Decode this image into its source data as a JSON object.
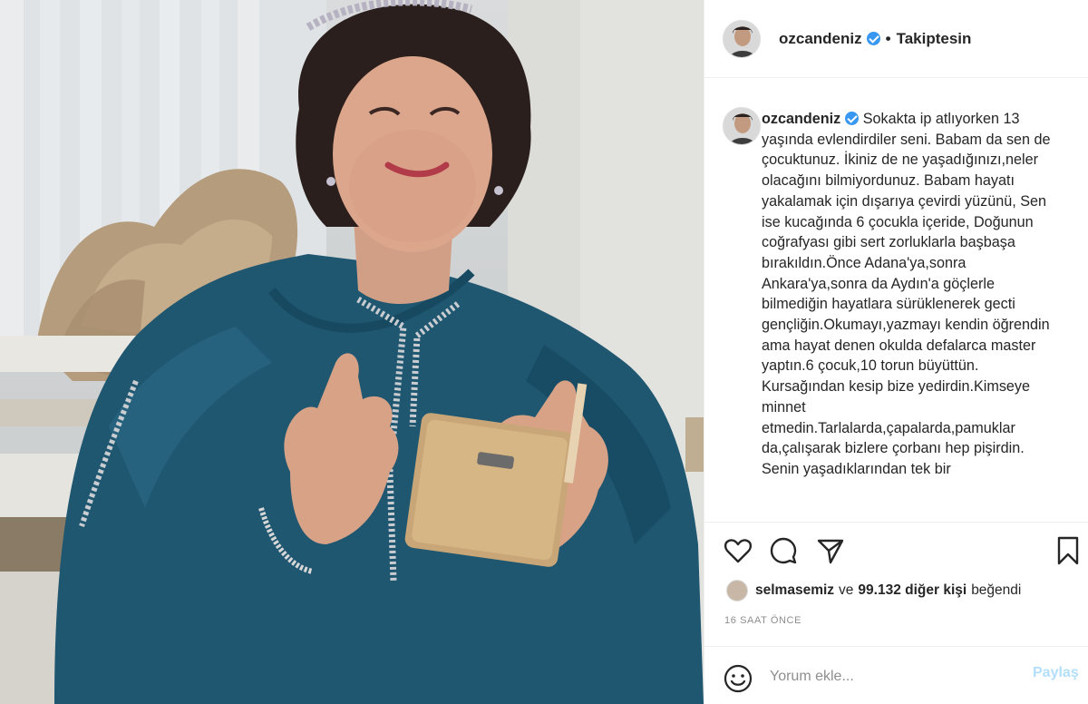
{
  "post": {
    "username": "ozcandeniz",
    "follow_status": "Takiptesin",
    "caption": "Sokakta ip atlıyorken 13 yaşında evlendirdiler seni. Babam da sen de çocuktunuz. İkiniz de ne yaşadığınızı,neler olacağını bilmiyordunuz. Babam hayatı yakalamak için dışarıya çevirdi yüzünü, Sen ise kucağında 6 çocukla içeride, Doğunun coğrafyası gibi sert zorluklarla başbaşa bırakıldın.Önce Adana'ya,sonra Ankara'ya,sonra da Aydın'a göçlerle bilmediğin hayatlara sürüklenerek gecti gençliğin.Okumayı,yazmayı kendin öğrendin ama hayat denen okulda defalarca master yaptın.6 çocuk,10 torun büyüttün. Kursağından kesip bize yedirdin.Kimseye minnet etmedin.Tarlalarda,çapalarda,pamuklar da,çalışarak bizlere çorbanı hep pişirdin. Senin yaşadıklarından tek bir",
    "likes": {
      "liker": "selmasemiz",
      "connector": "ve",
      "count_text": "99.132 diğer kişi",
      "suffix": "beğendi"
    },
    "time_ago": "16 SAAT ÖNCE"
  },
  "comment": {
    "placeholder": "Yorum ekle...",
    "post_label": "Paylaş"
  },
  "icons": {
    "like": "heart-icon",
    "comment": "comment-icon",
    "share": "share-icon",
    "save": "bookmark-icon",
    "emoji": "smiley-icon",
    "verified": "verified-badge-icon"
  },
  "colors": {
    "verified": "#3897f0",
    "muted_text": "#8e8e8e",
    "post_button_disabled": "#b2dffc",
    "border": "#efefef"
  }
}
